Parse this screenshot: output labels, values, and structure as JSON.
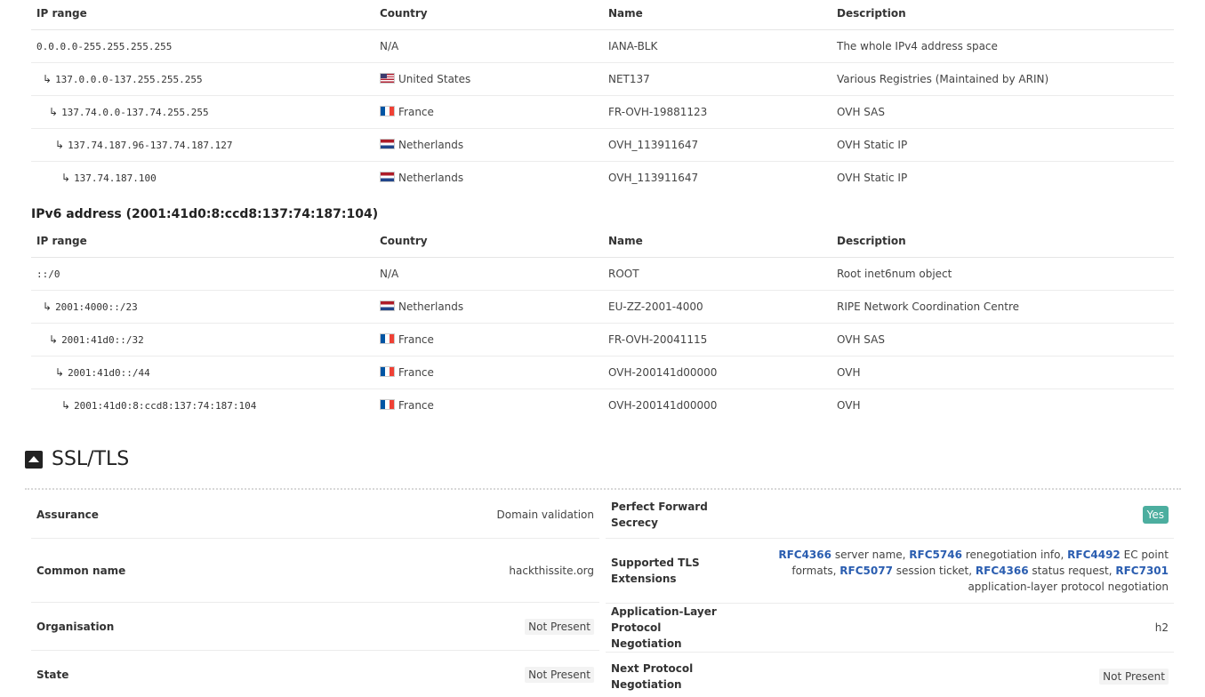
{
  "ipv4_table": {
    "headers": {
      "ip_range": "IP range",
      "country": "Country",
      "name": "Name",
      "description": "Description"
    },
    "rows": [
      {
        "indent": 0,
        "ip_range": "0.0.0.0-255.255.255.255",
        "flag": "",
        "country": "N/A",
        "name": "IANA-BLK",
        "description": "The whole IPv4 address space"
      },
      {
        "indent": 1,
        "ip_range": "137.0.0.0-137.255.255.255",
        "flag": "us",
        "country": "United States",
        "name": "NET137",
        "description": "Various Registries (Maintained by ARIN)"
      },
      {
        "indent": 2,
        "ip_range": "137.74.0.0-137.74.255.255",
        "flag": "fr",
        "country": "France",
        "name": "FR-OVH-19881123",
        "description": "OVH SAS"
      },
      {
        "indent": 3,
        "ip_range": "137.74.187.96-137.74.187.127",
        "flag": "nl",
        "country": "Netherlands",
        "name": "OVH_113911647",
        "description": "OVH Static IP"
      },
      {
        "indent": 4,
        "ip_range": "137.74.187.100",
        "flag": "nl",
        "country": "Netherlands",
        "name": "OVH_113911647",
        "description": "OVH Static IP"
      }
    ]
  },
  "ipv6_heading": "IPv6 address (2001:41d0:8:ccd8:137:74:187:104)",
  "ipv6_table": {
    "headers": {
      "ip_range": "IP range",
      "country": "Country",
      "name": "Name",
      "description": "Description"
    },
    "rows": [
      {
        "indent": 0,
        "ip_range": "::/0",
        "flag": "",
        "country": "N/A",
        "name": "ROOT",
        "description": "Root inet6num object"
      },
      {
        "indent": 1,
        "ip_range": "2001:4000::/23",
        "flag": "nl",
        "country": "Netherlands",
        "name": "EU-ZZ-2001-4000",
        "description": "RIPE Network Coordination Centre"
      },
      {
        "indent": 2,
        "ip_range": "2001:41d0::/32",
        "flag": "fr",
        "country": "France",
        "name": "FR-OVH-20041115",
        "description": "OVH SAS"
      },
      {
        "indent": 3,
        "ip_range": "2001:41d0::/44",
        "flag": "fr",
        "country": "France",
        "name": "OVH-200141d00000",
        "description": "OVH"
      },
      {
        "indent": 4,
        "ip_range": "2001:41d0:8:ccd8:137:74:187:104",
        "flag": "fr",
        "country": "France",
        "name": "OVH-200141d00000",
        "description": "OVH"
      }
    ]
  },
  "indent_arrow": "↳",
  "ssl_section": {
    "title": "SSL/TLS",
    "toggle_icon": "collapse-triangle-icon",
    "left_rows": [
      {
        "label": "Assurance",
        "value": "Domain validation",
        "chip": false
      },
      {
        "label": "Common name",
        "value": "hackthissite.org",
        "chip": false
      },
      {
        "label": "Organisation",
        "value": "Not Present",
        "chip": true
      },
      {
        "label": "State",
        "value": "Not Present",
        "chip": true
      }
    ],
    "pfs": {
      "label": "Perfect Forward Secrecy",
      "value": "Yes",
      "badge_color": "#4cae9f"
    },
    "tls_extensions": {
      "label": "Supported TLS Extensions",
      "items": [
        {
          "rfc": "RFC4366",
          "text": "server name"
        },
        {
          "rfc": "RFC5746",
          "text": "renegotiation info"
        },
        {
          "rfc": "RFC4492",
          "text": "EC point formats"
        },
        {
          "rfc": "RFC5077",
          "text": "session ticket"
        },
        {
          "rfc": "RFC4366",
          "text": "status request"
        },
        {
          "rfc": "RFC7301",
          "text": "application-layer protocol negotiation"
        }
      ]
    },
    "alpn": {
      "label": "Application-Layer Protocol Negotiation",
      "value": "h2"
    },
    "npn": {
      "label": "Next Protocol Negotiation",
      "value": "Not Present"
    }
  },
  "colors": {
    "rfc_link": "#2a5db0",
    "yes_badge": "#4cae9f"
  }
}
